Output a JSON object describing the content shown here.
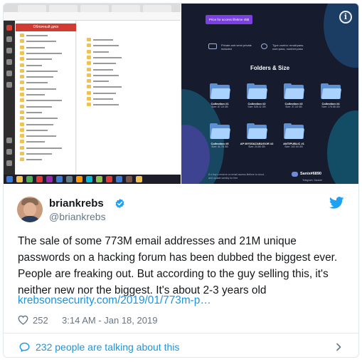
{
  "media": {
    "left_screenshot": {
      "red_header_label": "Облачный диск"
    },
    "right_screenshot": {
      "price_button": "Price for access lifetime 45$",
      "features": [
        "Private and semi private included",
        "Type combo: email:pass, user:pass, number:pass"
      ],
      "section_title": "Folders & Size",
      "folders": [
        {
          "name": "Collection #1",
          "size": "Size: 87.18 GB"
        },
        {
          "name": "Collection #2",
          "size": "Size: 526.11 GB"
        },
        {
          "name": "Collection #3",
          "size": "Size: 37.18 GB"
        },
        {
          "name": "Collection #4",
          "size": "Size: 178.58 GB"
        },
        {
          "name": "Collection #5",
          "size": "Size: 41.78 GB"
        },
        {
          "name": "AP MYSS&ZABUGOR #2",
          "size": "Size: 24.85 GB"
        },
        {
          "name": "ANTIPUBLIC #1",
          "size": "Size: 102.04 GB"
        }
      ],
      "footnote": "If u buy u recieve on email access lifetime to cloud , and update weekly for free",
      "contact": "Sanix#6890",
      "contact_sub": "Telegram: Sanixer"
    }
  },
  "tweet": {
    "author_name": "briankrebs",
    "handle": "@briankrebs",
    "text": "The sale of some 773M email addresses and 21M unique passwords on a hacking forum has been dubbed the biggest ever. People are freaking out. But according to the guy selling this, it's neither new nor the biggest. It's about 2-3 years old",
    "link": "krebsonsecurity.com/2019/01/773m-p…",
    "likes": "252",
    "timestamp": "3:14 AM - Jan 18, 2019",
    "talking": "232 people are talking about this"
  },
  "colors": {
    "twitter_blue": "#1da1f2",
    "link_blue": "#1b95e0",
    "meta_gray": "#657786",
    "text_dark": "#14171a"
  },
  "icons": [
    "info-icon",
    "verified-icon",
    "twitter-logo-icon",
    "heart-icon",
    "speech-bubble-icon",
    "chevron-right-icon",
    "discord-icon"
  ]
}
